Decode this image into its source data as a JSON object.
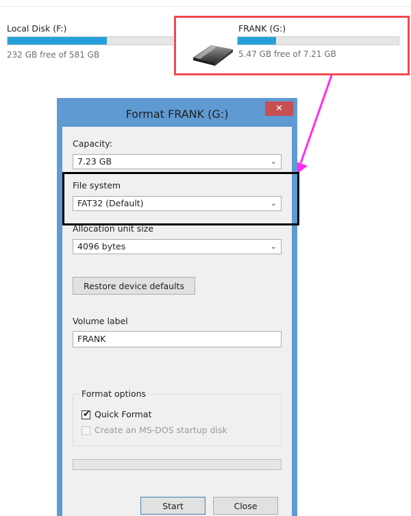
{
  "drives": {
    "local": {
      "name": "Local Disk (F:)",
      "free_text": "232 GB free of 581 GB",
      "used_fraction": 0.6
    },
    "frank": {
      "name": "FRANK (G:)",
      "free_text": "5.47 GB free of 7.21 GB",
      "used_fraction": 0.24
    }
  },
  "dialog": {
    "title": "Format FRANK (G:)",
    "close_symbol": "✕",
    "capacity": {
      "label": "Capacity:",
      "value": "7.23 GB"
    },
    "file_system": {
      "label": "File system",
      "value": "FAT32 (Default)"
    },
    "allocation": {
      "label": "Allocation unit size",
      "value": "4096 bytes"
    },
    "restore_button": "Restore device defaults",
    "volume_label": {
      "label": "Volume label",
      "value": "FRANK"
    },
    "format_options": {
      "title": "Format options",
      "quick_format": {
        "label": "Quick Format",
        "checked": true
      },
      "msdos": {
        "label": "Create an MS-DOS startup disk",
        "checked": false,
        "enabled": false
      }
    },
    "progress": 0,
    "start_button": "Start",
    "close_button": "Close"
  },
  "icons": {
    "chevron": "⌄",
    "check": "✔"
  },
  "colors": {
    "accent": "#26a0da",
    "highlight_red": "#ef4a4f",
    "callout_arrow": "#ff2cf2",
    "dialog_frame": "#5f9ad3",
    "close_red": "#c74f50"
  }
}
